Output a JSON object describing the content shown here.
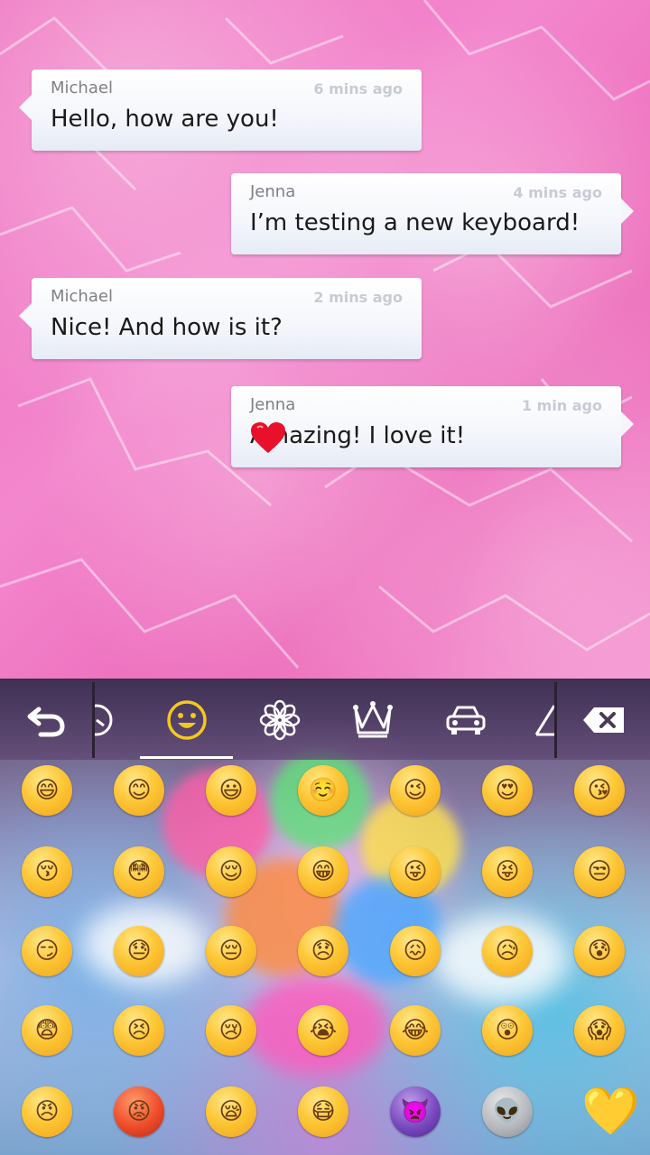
{
  "messages": [
    {
      "sender": "Michael",
      "time": "6 mins ago",
      "text": "Hello, how are you!",
      "side": "left"
    },
    {
      "sender": "Jenna",
      "time": "4 mins ago",
      "text": "I’m testing a new keyboard!",
      "side": "right"
    },
    {
      "sender": "Michael",
      "time": "2 mins ago",
      "text": "Nice! And how is it?",
      "side": "left"
    },
    {
      "sender": "Jenna",
      "time": "1 min ago",
      "text": "Amazing! I love it!",
      "side": "right"
    }
  ],
  "colors": {
    "chat_background": "#ef7bc6",
    "heart": "#e8102a",
    "active_tab_underline": "#ffffff"
  },
  "keyboard": {
    "toolbar": {
      "back_icon": "undo-arrow-icon",
      "recent_icon": "clock-icon",
      "tabs": [
        {
          "icon": "smiley-icon",
          "active": true
        },
        {
          "icon": "flower-icon",
          "active": false
        },
        {
          "icon": "crown-icon",
          "active": false
        },
        {
          "icon": "car-icon",
          "active": false
        },
        {
          "icon": "triangle-symbols-icon",
          "active": false
        }
      ],
      "delete_icon": "backspace-icon"
    },
    "emoji_rows": [
      [
        "😄",
        "😊",
        "😃",
        "☺️",
        "😉",
        "😍",
        "😘"
      ],
      [
        "😚",
        "😳",
        "😌",
        "😁",
        "😜",
        "😝",
        "😒"
      ],
      [
        "😏",
        "😓",
        "😔",
        "😞",
        "😖",
        "😥",
        "😰"
      ],
      [
        "😨",
        "😣",
        "😢",
        "😭",
        "😂",
        "😲",
        "😱"
      ],
      [
        "😠",
        "😡",
        "😪",
        "😷",
        "👿",
        "👽",
        "💛"
      ]
    ]
  }
}
